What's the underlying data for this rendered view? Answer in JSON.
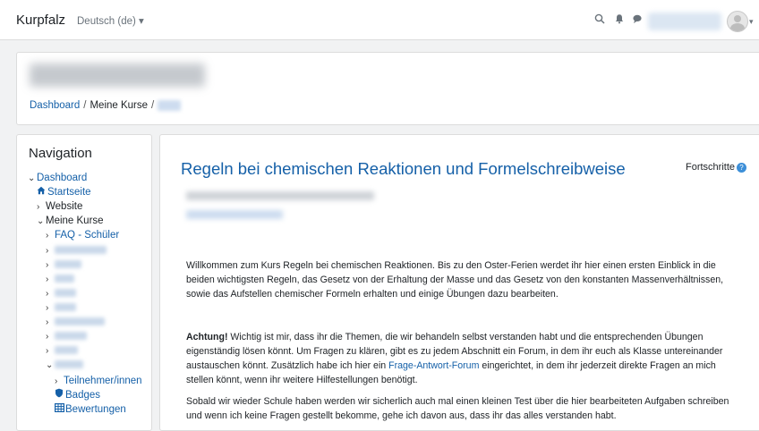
{
  "topbar": {
    "brand": "Kurpfalz",
    "language": "Deutsch (de) ▾",
    "icons": [
      "search-icon",
      "bell-icon",
      "chat-icon"
    ]
  },
  "header": {
    "breadcrumb": {
      "dashboard": "Dashboard",
      "sep": "/",
      "my_courses": "Meine Kurse"
    }
  },
  "navigation": {
    "title": "Navigation",
    "dashboard": "Dashboard",
    "startseite": "Startseite",
    "website": "Website",
    "meine_kurse": "Meine Kurse",
    "faq": "FAQ - Schüler",
    "teilnehmer": "Teilnehmer/innen",
    "badges": "Badges",
    "bewertungen": "Bewertungen"
  },
  "main": {
    "title": "Regeln bei chemischen Reaktionen und Formelschreibweise",
    "progress_label": "Fortschritte",
    "intro": "Willkommen zum Kurs Regeln bei chemischen Reaktionen. Bis zu den Oster-Ferien werdet ihr hier einen ersten Einblick in die beiden wichtigsten Regeln, das Gesetz von der Erhaltung der Masse und das Gesetz von den konstanten Massenverhältnissen, sowie das Aufstellen chemischer Formeln erhalten und einige Übungen dazu bearbeiten.",
    "achtung_label": "Achtung!",
    "achtung_text_1": " Wichtig ist mir, dass ihr die Themen, die wir behandeln selbst verstanden habt und die entsprechenden Übungen eigenständig lösen könnt. Um Fragen zu klären, gibt es zu jedem Abschnitt ein Forum, in dem ihr euch als Klasse untereinander austauschen könnt. Zusätzlich habe ich hier ein ",
    "forum_link": "Frage-Antwort-Forum",
    "achtung_text_2": " eingerichtet, in dem ihr jederzeit direkte Fragen an mich stellen könnt, wenn ihr weitere Hilfestellungen benötigt.",
    "closing": "Sobald wir wieder Schule haben werden wir sicherlich auch mal einen kleinen Test über die hier bearbeiteten Aufgaben schreiben und wenn ich keine Fragen gestellt bekomme, gehe ich davon aus, dass ihr das alles verstanden habt."
  },
  "colors": {
    "link": "#1560a8",
    "background": "#f1f2f3",
    "card": "#ffffff"
  }
}
